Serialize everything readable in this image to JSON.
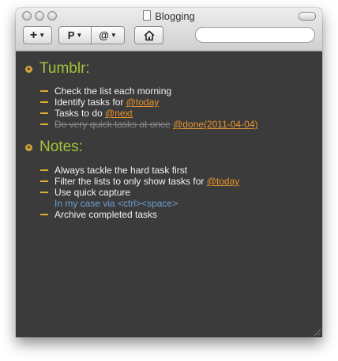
{
  "window": {
    "title": "Blogging"
  },
  "toolbar": {
    "add_label": "+",
    "project_label": "P",
    "context_label": "@",
    "search": {
      "value": "",
      "placeholder": ""
    }
  },
  "projects": [
    {
      "name": "Tumblr:",
      "tasks": [
        {
          "text": "Check the list each morning"
        },
        {
          "text": "Identify tasks for ",
          "tag": "@today"
        },
        {
          "text": "Tasks to do ",
          "tag": "@next"
        },
        {
          "text": "Do very quick tasks at once",
          "tag": "@done(2011-04-04)",
          "done": true
        }
      ]
    },
    {
      "name": "Notes:",
      "tasks": [
        {
          "text": "Always tackle the hard task first"
        },
        {
          "text": "Filter the lists to only show tasks for ",
          "tag": "@today"
        },
        {
          "text": "Use quick capture",
          "note": "In my case via <ctrl><space>"
        },
        {
          "text": "Archive completed tasks"
        }
      ]
    }
  ],
  "colors": {
    "background": "#3b3b3b",
    "project": "#a4c43a",
    "bullet": "#d6a235",
    "tag": "#e8932c",
    "note": "#6d9fd4",
    "done": "#8a8a8a"
  }
}
